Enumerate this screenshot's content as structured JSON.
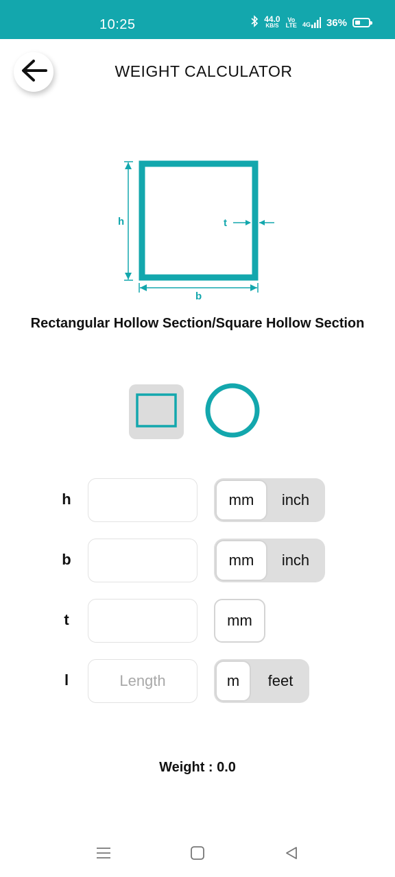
{
  "status_bar": {
    "time": "10:25",
    "net_speed": "44.0",
    "net_unit": "KB/S",
    "volte_top": "Vo",
    "volte_bottom": "LTE",
    "signal_label": "4G",
    "battery": "36%",
    "icons": [
      "bluetooth-icon",
      "volte-icon",
      "signal-icon",
      "battery-icon"
    ]
  },
  "header": {
    "title": "WEIGHT CALCULATOR",
    "back_icon": "arrow-left-icon"
  },
  "diagram": {
    "label_h": "h",
    "label_b": "b",
    "label_t": "t",
    "accent": "#13a7ad"
  },
  "section_name": "Rectangular Hollow Section/Square Hollow Section",
  "shape_selector": {
    "options": [
      "rectangle-icon",
      "circle-icon"
    ],
    "selected": "rectangle-icon"
  },
  "fields": [
    {
      "label": "h",
      "value": "",
      "placeholder": "",
      "units": [
        "mm",
        "inch"
      ],
      "selected_unit": "mm"
    },
    {
      "label": "b",
      "value": "",
      "placeholder": "",
      "units": [
        "mm",
        "inch"
      ],
      "selected_unit": "mm"
    },
    {
      "label": "t",
      "value": "",
      "placeholder": "",
      "units": [
        "mm"
      ],
      "selected_unit": "mm"
    },
    {
      "label": "l",
      "value": "",
      "placeholder": "Length",
      "units": [
        "m",
        "feet"
      ],
      "selected_unit": "m"
    }
  ],
  "result": {
    "text": "Weight : 0.0"
  },
  "nav_bar": {
    "icons": [
      "menu-icon",
      "home-square-icon",
      "back-triangle-icon"
    ]
  },
  "colors": {
    "status_bar": "#13a7ad",
    "accent": "#13a7ad",
    "toggle_bg": "#dedede"
  }
}
